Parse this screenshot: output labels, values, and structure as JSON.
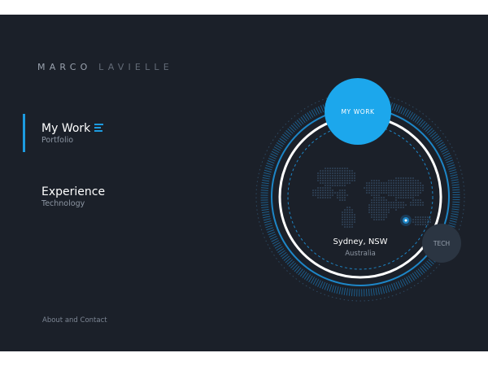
{
  "brand": {
    "part1": "MARCO ",
    "part2": "LAVIELLE"
  },
  "nav": {
    "items": [
      {
        "title": "My Work",
        "subtitle": "Portfolio"
      },
      {
        "title": "Experience",
        "subtitle": "Technology"
      }
    ],
    "about_contact": "About and Contact"
  },
  "globe": {
    "top_button": "MY WORK",
    "side_button": "TECH",
    "location_city": "Sydney, NSW",
    "location_country": "Australia"
  },
  "colors": {
    "background": "#1b2029",
    "accent": "#1ca7ec",
    "text_primary": "#ffffff",
    "text_secondary": "#8d96a3"
  },
  "icons": {
    "menu": "menu-lines-icon",
    "location_marker": "location-pin-icon"
  }
}
